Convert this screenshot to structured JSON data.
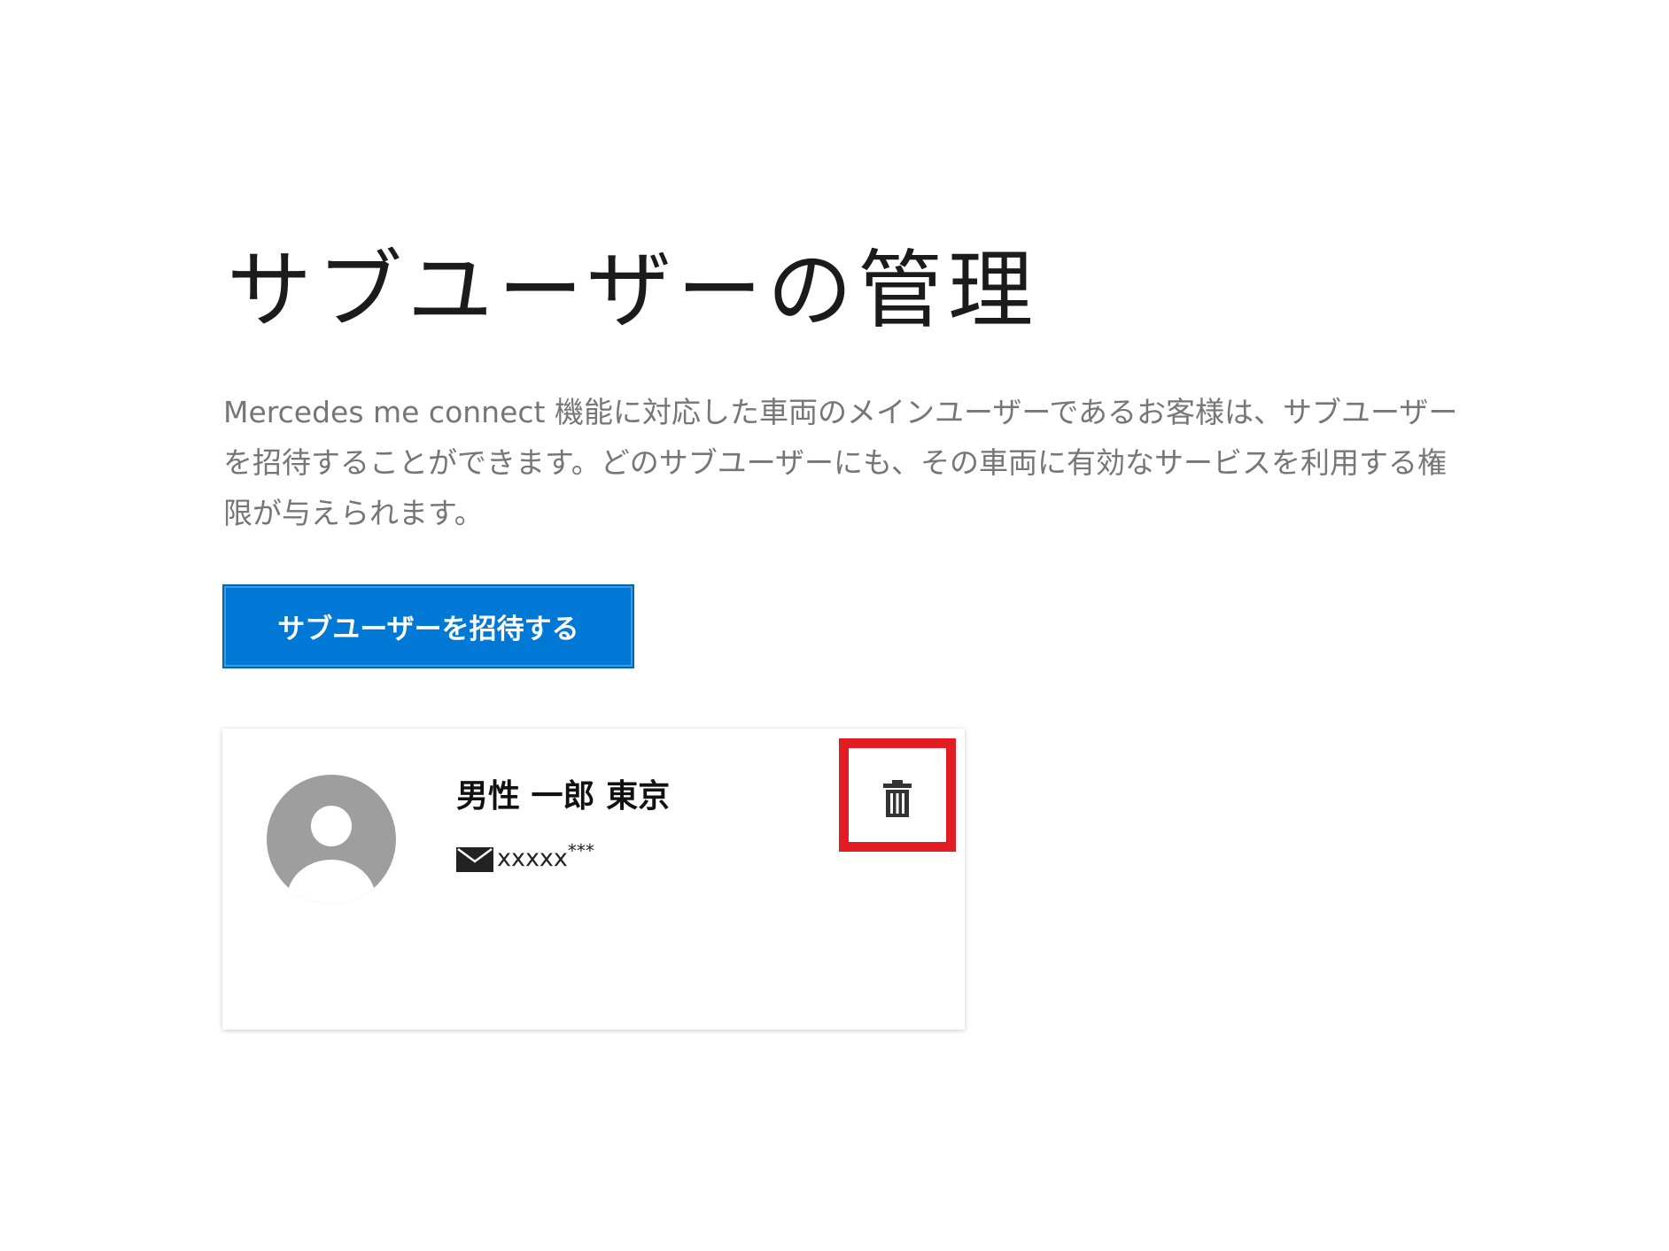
{
  "page": {
    "title": "サブユーザーの管理",
    "description": "Mercedes me connect 機能に対応した車両のメインユーザーであるお客様は、サブユーザーを招待することができます。どのサブユーザーにも、その車両に有効なサービスを利用する権限が与えられます。"
  },
  "actions": {
    "invite_label": "サブユーザーを招待する"
  },
  "sub_users": [
    {
      "name": "男性 一郎 東京",
      "email": "xxxxx",
      "email_masked_suffix": "***",
      "avatar_icon": "person-avatar-icon",
      "mail_icon": "envelope-icon",
      "delete_icon": "trash-icon"
    }
  ],
  "colors": {
    "primary_button": "#0078d6",
    "highlight": "#e31b23",
    "title_text": "#1b1b1b",
    "description_text": "#767676",
    "avatar_gray": "#9e9e9e"
  }
}
